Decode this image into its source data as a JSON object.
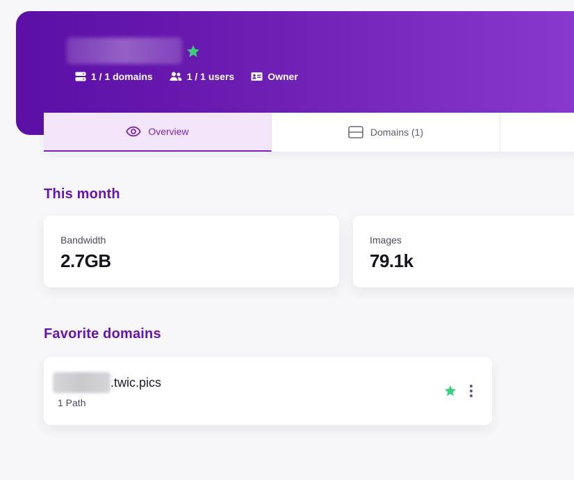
{
  "organization": {
    "name": "organization",
    "favorite": true,
    "favorite_icon": "star-icon",
    "star_color": "#3fce7e",
    "meta": {
      "domains": "1 / 1 domains",
      "users": "1 / 1 users",
      "role": "Owner"
    }
  },
  "tabs": [
    {
      "label": "Overview",
      "icon": "eye-icon",
      "active": true
    },
    {
      "label": "Domains (1)",
      "icon": "server-icon",
      "active": false
    }
  ],
  "this_month": {
    "title": "This month",
    "bandwidth_label": "Bandwidth",
    "bandwidth_value": "2.7GB",
    "images_label": "Images",
    "images_value": "79.1k"
  },
  "favorite_domains": {
    "title": "Favorite domains",
    "items": [
      {
        "subdomain": "subdomain",
        "suffix": ".twic.pics",
        "paths": "1 Path"
      }
    ]
  },
  "colors": {
    "accent": "#6a12ad",
    "banner_start": "#5b0fa6",
    "banner_end": "#8a3ccf",
    "tab_active_bg": "#f3e6fb"
  }
}
